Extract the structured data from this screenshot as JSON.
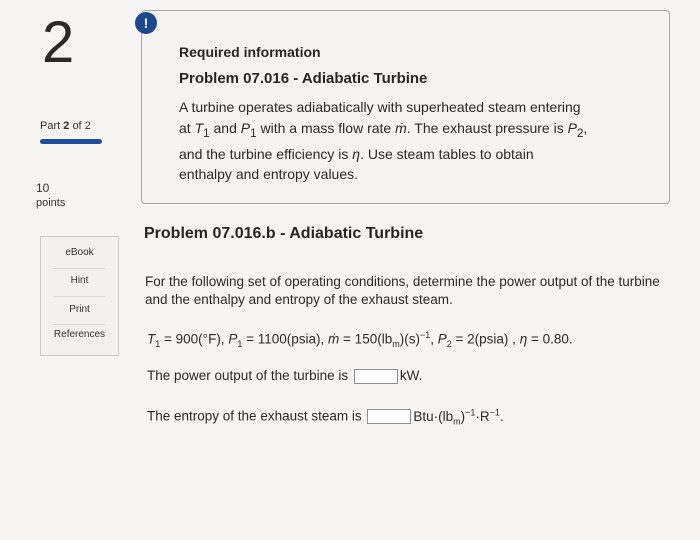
{
  "question": {
    "number": "2"
  },
  "part": {
    "prefix": "Part",
    "current": "2",
    "of_text": "of",
    "total": "2"
  },
  "points": {
    "value": "10",
    "label": "points"
  },
  "side_buttons": {
    "ebook": "eBook",
    "hint": "Hint",
    "print": "Print",
    "references": "References"
  },
  "alert": {
    "symbol": "!"
  },
  "required": {
    "title": "Required information",
    "problem": "Problem 07.016 - Adiabatic Turbine",
    "body": {
      "t1": "A turbine operates adiabatically with superheated steam entering at ",
      "T1": "T",
      "T1sub": "1",
      "and": " and ",
      "P1": "P",
      "P1sub": "1",
      "t2": " with a mass flow rate ",
      "mdot": "ṁ",
      "t3": ". The exhaust pressure is ",
      "P2": "P",
      "P2sub": "2",
      "t4": ", and the turbine efficiency is ",
      "eta": "η",
      "t5": ". Use steam tables to obtain enthalpy and entropy values."
    }
  },
  "subproblem": {
    "title": "Problem 07.016.b - Adiabatic Turbine",
    "instructions": "For the following set of operating conditions, determine the power output of the turbine and the enthalpy and entropy of the exhaust steam.",
    "given": {
      "T1": "T",
      "T1sub": "1",
      "T1val": " = 900(°F), ",
      "P1": "P",
      "P1sub": "1",
      "P1val": " = 1100(psia), ",
      "mdot": "ṁ",
      "mval": " = 150(lb",
      "msub": "m",
      "mval2": ")(s)",
      "msup": "−1",
      "sep": ", ",
      "P2": "P",
      "P2sub": "2",
      "P2val": " = 2(psia) , ",
      "eta": "η",
      "etaval": " = 0.80."
    }
  },
  "answers": {
    "power_label": "The power output of the turbine is",
    "power_value": "",
    "power_unit": "kW.",
    "entropy_label": "The entropy of the exhaust steam is",
    "entropy_value": "",
    "entropy_unit_a": "Btu·(lb",
    "entropy_unit_sub": "m",
    "entropy_unit_b": ")",
    "entropy_unit_sup": "−1",
    "entropy_unit_c": "·R",
    "entropy_unit_sup2": "−1",
    "entropy_unit_d": "."
  },
  "colors": {
    "accent": "#1f4e9c",
    "alert": "#1c4792"
  }
}
